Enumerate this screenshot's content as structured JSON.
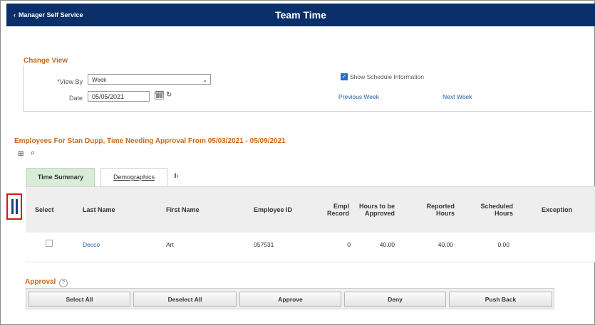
{
  "header": {
    "back_label": "Manager Self Service",
    "title": "Team Time"
  },
  "change_view": {
    "title": "Change View",
    "view_by_label": "*View By",
    "view_by_value": "Week",
    "date_label": "Date",
    "date_value": "05/05/2021",
    "show_schedule_label": "Show Schedule Information",
    "show_schedule_checked": true,
    "previous_week": "Previous Week",
    "next_week": "Next Week"
  },
  "employees": {
    "title": "Employees For Stan Dupp, Time Needing Approval From 05/03/2021 - 05/09/2021",
    "tabs": [
      {
        "label": "Time Summary",
        "active": true
      },
      {
        "label": "Demographics",
        "active": false
      }
    ],
    "columns": {
      "select": "Select",
      "last_name": "Last Name",
      "first_name": "First Name",
      "employee_id": "Employee ID",
      "empl_record_1": "Empl",
      "empl_record_2": "Record",
      "hours_to_approve_1": "Hours to be",
      "hours_to_approve_2": "Approved",
      "reported_hours_1": "Reported",
      "reported_hours_2": "Hours",
      "scheduled_hours_1": "Scheduled",
      "scheduled_hours_2": "Hours",
      "exception": "Exception"
    },
    "rows": [
      {
        "last_name": "Decco",
        "first_name": "Art",
        "employee_id": "057531",
        "empl_record": "0",
        "hours_to_approve": "40.00",
        "reported_hours": "40.00",
        "scheduled_hours": "0.00",
        "exception": ""
      }
    ]
  },
  "approval": {
    "title": "Approval",
    "buttons": {
      "select_all": "Select All",
      "deselect_all": "Deselect All",
      "approve": "Approve",
      "deny": "Deny",
      "push_back": "Push Back"
    }
  },
  "icons": {
    "back": "chevron-left-icon",
    "calendar": "calendar-icon",
    "refresh": "refresh-icon",
    "personalize": "grid-personalize-icon",
    "search": "search-icon",
    "help": "help-icon",
    "show_all_columns": "show-all-columns-icon",
    "column_handle": "pause-handle-icon"
  },
  "colors": {
    "header_bg": "#0a2f69",
    "section_title": "#c56a1e",
    "link": "#1f5aa8",
    "active_tab": "#d8ecd8",
    "highlight": "#d11a1a"
  }
}
